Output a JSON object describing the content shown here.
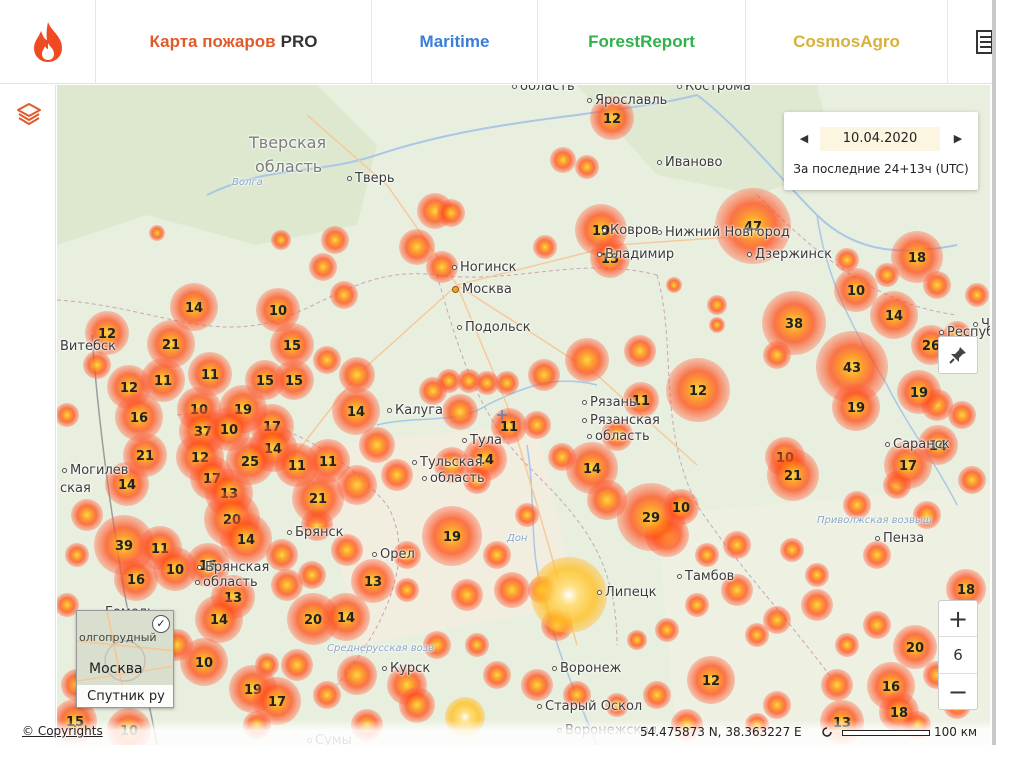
{
  "nav": {
    "tabs": [
      {
        "label": "Карта пожаров",
        "suffix": "PRO",
        "color": "#e05a2b"
      },
      {
        "label": "Maritime",
        "color": "#3b7ddd"
      },
      {
        "label": "ForestReport",
        "color": "#2fb24a"
      },
      {
        "label": "CosmosAgro",
        "color": "#d8b13a"
      }
    ],
    "logo_icon": "flame-icon",
    "docs_icon": "document-icon"
  },
  "toolbar": {
    "layers_icon": "layers-icon"
  },
  "date_panel": {
    "date": "10.04.2020",
    "period": "За последние 24+13ч (UTC)",
    "prev_icon": "chevron-left-icon",
    "next_icon": "chevron-right-icon"
  },
  "zoom": {
    "in_label": "+",
    "level": "6",
    "out_label": "−"
  },
  "minimap": {
    "label": "Спутник ру",
    "city": "Москва",
    "town": "олгопрудный",
    "check": "✓"
  },
  "footer": {
    "copyrights": "© Copyrights",
    "coords": "54.475873 N, 38.363227 E",
    "scale": "100 км"
  },
  "colors": {
    "fire_core": "#ff3b00",
    "fire_mid": "#ff7a00",
    "fire_outer": "#ffb070",
    "water": "#a9c7e6",
    "land": "#e8eedd"
  },
  "places": [
    {
      "name": "Тверская",
      "kind": "big"
    },
    {
      "name": "область",
      "kind": "big"
    },
    {
      "name": "Тверь",
      "kind": "city"
    },
    {
      "name": "Волга",
      "kind": "river"
    },
    {
      "name": "Ярославль",
      "kind": "city"
    },
    {
      "name": "Кострома",
      "kind": "city"
    },
    {
      "name": "область",
      "kind": "city"
    },
    {
      "name": "Иваново",
      "kind": "city"
    },
    {
      "name": "Нижний Новгород",
      "kind": "city"
    },
    {
      "name": "Дзержинск",
      "kind": "city"
    },
    {
      "name": "Ногинск",
      "kind": "city"
    },
    {
      "name": "Москва",
      "kind": "capital"
    },
    {
      "name": "Подольск",
      "kind": "city"
    },
    {
      "name": "Владимир",
      "kind": "city"
    },
    {
      "name": "Ковров",
      "kind": "city"
    },
    {
      "name": "Калуга",
      "kind": "city"
    },
    {
      "name": "Тула",
      "kind": "city"
    },
    {
      "name": "Тульская",
      "kind": "city"
    },
    {
      "name": "область",
      "kind": "city"
    },
    {
      "name": "Рязань",
      "kind": "city"
    },
    {
      "name": "Рязанская",
      "kind": "city"
    },
    {
      "name": "область",
      "kind": "city"
    },
    {
      "name": "Брянск",
      "kind": "city"
    },
    {
      "name": "Орел",
      "kind": "city"
    },
    {
      "name": "Могилев",
      "kind": "city"
    },
    {
      "name": "Витебск",
      "kind": "city"
    },
    {
      "name": "ская",
      "kind": "city"
    },
    {
      "name": "Тамбов",
      "kind": "city"
    },
    {
      "name": "Липецк",
      "kind": "city"
    },
    {
      "name": "Пенза",
      "kind": "city"
    },
    {
      "name": "Саранск",
      "kind": "city"
    },
    {
      "name": "Чуваш",
      "kind": "city"
    },
    {
      "name": "Респуб",
      "kind": "city"
    },
    {
      "name": "Курск",
      "kind": "city"
    },
    {
      "name": "Воронеж",
      "kind": "city"
    },
    {
      "name": "Старый Оскол",
      "kind": "city"
    },
    {
      "name": "Сумы",
      "kind": "city"
    },
    {
      "name": "Гомель",
      "kind": "city"
    },
    {
      "name": "Воронежская",
      "kind": "city"
    },
    {
      "name": "Среднерусская возв",
      "kind": "river"
    },
    {
      "name": "Приволжская возвыш",
      "kind": "river"
    },
    {
      "name": "Дон",
      "kind": "river"
    },
    {
      "name": "Брянская",
      "kind": "city"
    },
    {
      "name": "область",
      "kind": "city"
    }
  ],
  "clusters": [
    {
      "count": "12"
    },
    {
      "count": "19"
    },
    {
      "count": "15"
    },
    {
      "count": "47"
    },
    {
      "count": "18"
    },
    {
      "count": "10"
    },
    {
      "count": "14"
    },
    {
      "count": "38"
    },
    {
      "count": "26"
    },
    {
      "count": "43"
    },
    {
      "count": "19"
    },
    {
      "count": "19"
    },
    {
      "count": "14"
    },
    {
      "count": "17"
    },
    {
      "count": "12"
    },
    {
      "count": "11"
    },
    {
      "count": "10"
    },
    {
      "count": "21"
    },
    {
      "count": "14"
    },
    {
      "count": "29"
    },
    {
      "count": "10"
    },
    {
      "count": "14"
    },
    {
      "count": "11"
    },
    {
      "count": "14"
    },
    {
      "count": "19"
    },
    {
      "count": "14"
    },
    {
      "count": "10"
    },
    {
      "count": "12"
    },
    {
      "count": "15"
    },
    {
      "count": "21"
    },
    {
      "count": "11"
    },
    {
      "count": "11"
    },
    {
      "count": "15"
    },
    {
      "count": "15"
    },
    {
      "count": "12"
    },
    {
      "count": "16"
    },
    {
      "count": "10"
    },
    {
      "count": "19"
    },
    {
      "count": "37"
    },
    {
      "count": "10"
    },
    {
      "count": "17"
    },
    {
      "count": "14"
    },
    {
      "count": "11"
    },
    {
      "count": "21"
    },
    {
      "count": "12"
    },
    {
      "count": "25"
    },
    {
      "count": "11"
    },
    {
      "count": "17"
    },
    {
      "count": "13"
    },
    {
      "count": "20"
    },
    {
      "count": "14"
    },
    {
      "count": "21"
    },
    {
      "count": "39"
    },
    {
      "count": "11"
    },
    {
      "count": "16"
    },
    {
      "count": "10"
    },
    {
      "count": "15"
    },
    {
      "count": "14"
    },
    {
      "count": "13"
    },
    {
      "count": "14"
    },
    {
      "count": "20"
    },
    {
      "count": "14"
    },
    {
      "count": "13"
    },
    {
      "count": "10"
    },
    {
      "count": "19"
    },
    {
      "count": "17"
    },
    {
      "count": "15"
    },
    {
      "count": "10"
    },
    {
      "count": "18"
    },
    {
      "count": "20"
    },
    {
      "count": "16"
    },
    {
      "count": "18"
    },
    {
      "count": "12"
    },
    {
      "count": "13"
    }
  ]
}
